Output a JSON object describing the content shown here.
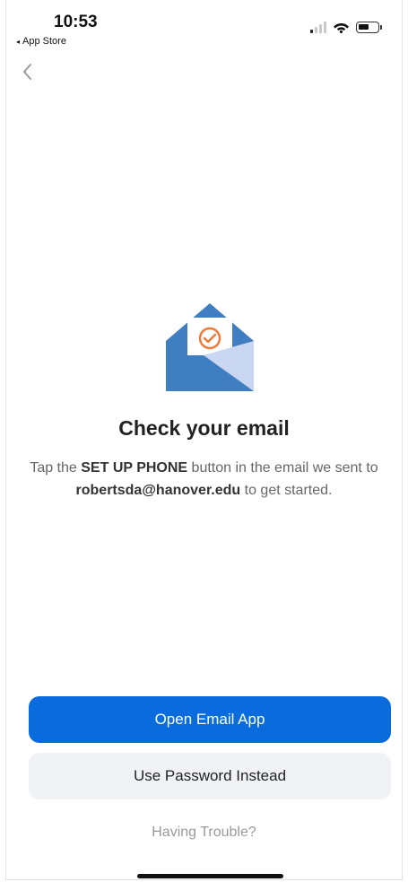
{
  "status_bar": {
    "time": "10:53",
    "back_app_label": "App Store",
    "back_app_arrow": "◂"
  },
  "nav": {
    "back_icon": "chevron-left-icon"
  },
  "illustration": {
    "icon": "email-check-icon",
    "colors": {
      "envelope": "#3f7ec1",
      "flap": "#cad7f2",
      "letter": "#ffffff",
      "check": "#ef7a3a"
    }
  },
  "content": {
    "title": "Check your email",
    "desc_part1": "Tap the ",
    "desc_bold1": "SET UP PHONE",
    "desc_part2": " button in the email we sent to ",
    "desc_email": "robertsda@hanover.edu",
    "desc_part3": " to get started."
  },
  "actions": {
    "primary_label": "Open Email App",
    "secondary_label": "Use Password Instead",
    "trouble_label": "Having Trouble?"
  },
  "colors": {
    "primary": "#0a6bdc",
    "secondary_bg": "#f1f2f6",
    "muted_text": "#9a9a9a"
  }
}
